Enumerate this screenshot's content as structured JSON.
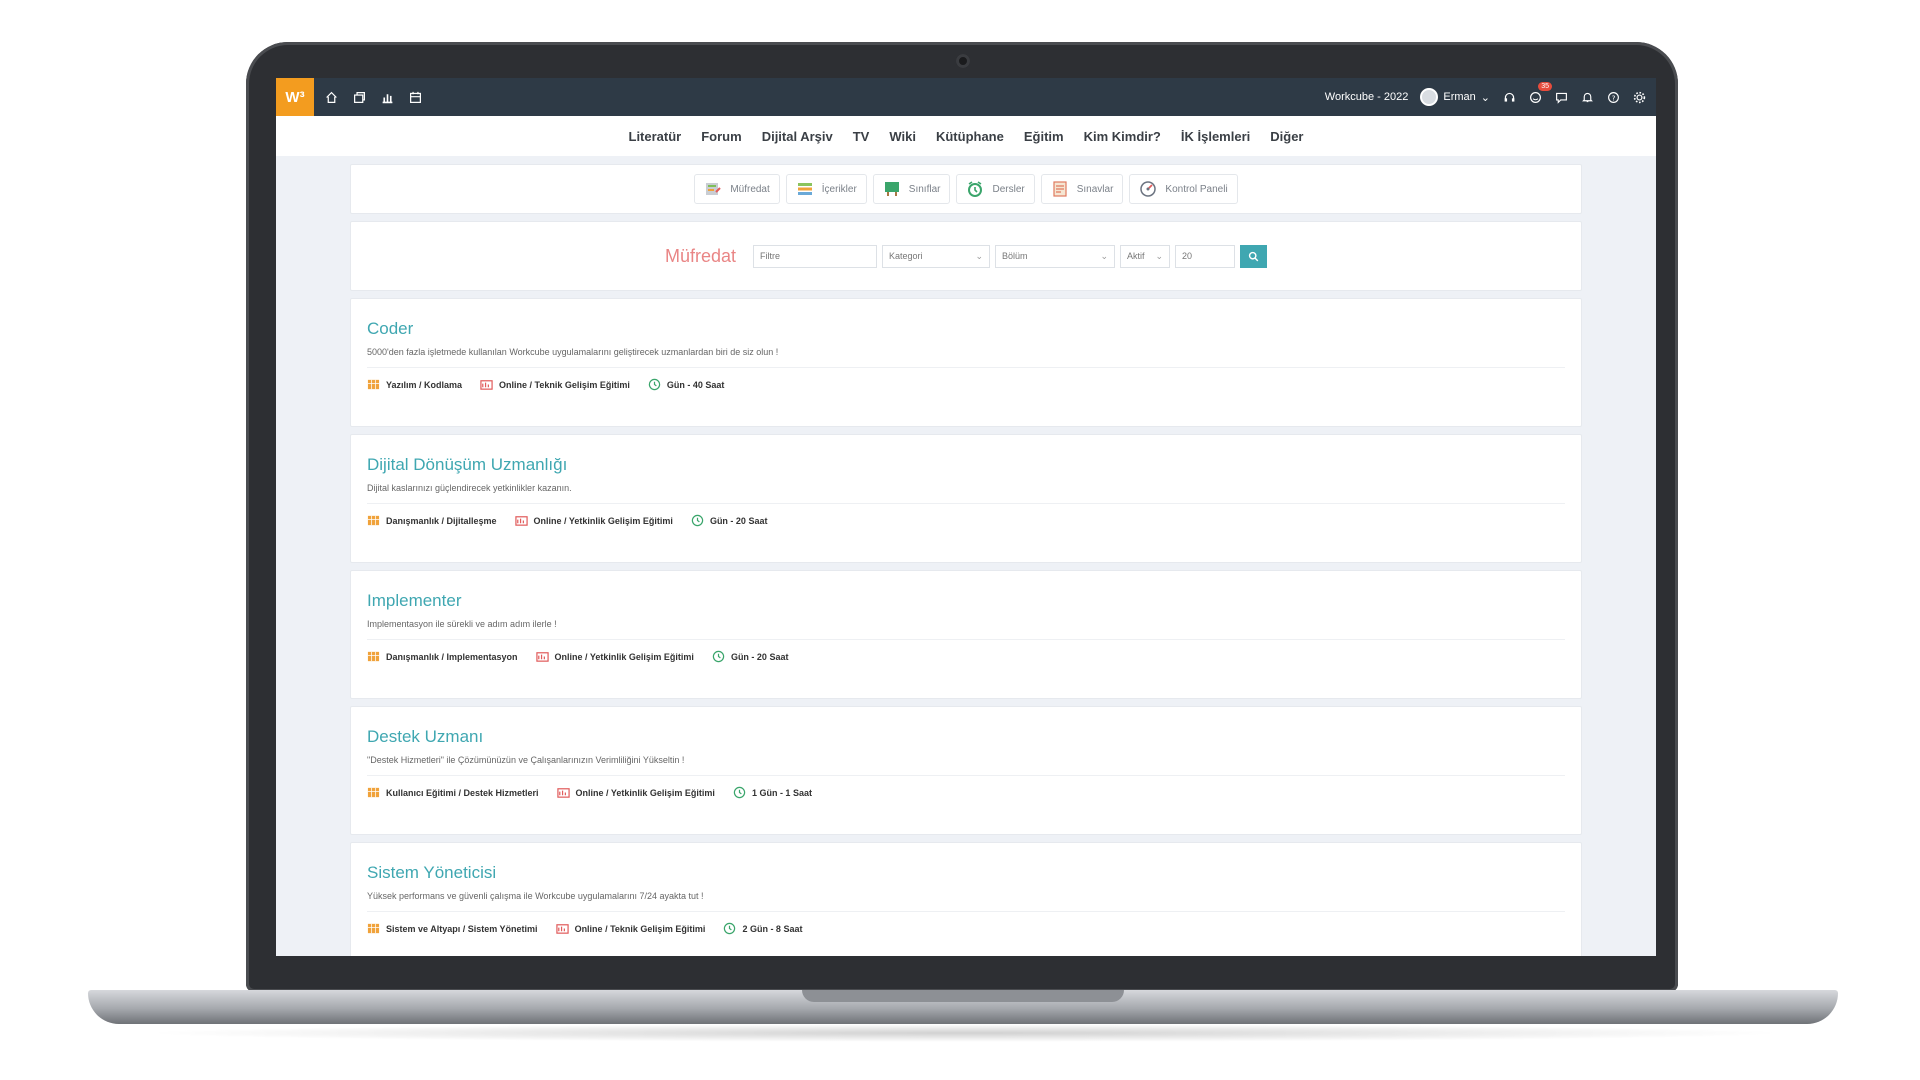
{
  "topbar": {
    "logo": "W³",
    "company": "Workcube - 2022",
    "user_name": "Erman",
    "notification_count": "35"
  },
  "mainnav": [
    "Literatür",
    "Forum",
    "Dijital Arşiv",
    "TV",
    "Wiki",
    "Kütüphane",
    "Eğitim",
    "Kim Kimdir?",
    "İK İşlemleri",
    "Diğer"
  ],
  "modules": [
    {
      "label": "Müfredat",
      "icon": "curriculum-icon"
    },
    {
      "label": "İçerikler",
      "icon": "contents-icon"
    },
    {
      "label": "Sınıflar",
      "icon": "classes-icon"
    },
    {
      "label": "Dersler",
      "icon": "lessons-icon"
    },
    {
      "label": "Sınavlar",
      "icon": "exams-icon"
    },
    {
      "label": "Kontrol Paneli",
      "icon": "dashboard-icon"
    }
  ],
  "filter": {
    "title": "Müfredat",
    "filter_placeholder": "Filtre",
    "category": "Kategori",
    "section": "Bölüm",
    "status": "Aktif",
    "count": "20"
  },
  "items": [
    {
      "title": "Coder",
      "desc": "5000'den fazla işletmede kullanılan Workcube uygulamalarını geliştirecek uzmanlardan biri de siz olun !",
      "category": "Yazılım / Kodlama",
      "type": "Online / Teknik Gelişim Eğitimi",
      "duration": "Gün - 40 Saat"
    },
    {
      "title": "Dijital Dönüşüm Uzmanlığı",
      "desc": "Dijital kaslarınızı güçlendirecek yetkinlikler kazanın.",
      "category": "Danışmanlık / Dijitalleşme",
      "type": "Online / Yetkinlik Gelişim Eğitimi",
      "duration": "Gün - 20 Saat"
    },
    {
      "title": "Implementer",
      "desc": "Implementasyon ile sürekli ve adım adım ilerle !",
      "category": "Danışmanlık / Implementasyon",
      "type": "Online / Yetkinlik Gelişim Eğitimi",
      "duration": "Gün - 20 Saat"
    },
    {
      "title": "Destek Uzmanı",
      "desc": "\"Destek Hizmetleri\" ile Çözümünüzün ve Çalışanlarınızın Verimliliğini Yükseltin !",
      "category": "Kullanıcı Eğitimi / Destek Hizmetleri",
      "type": "Online / Yetkinlik Gelişim Eğitimi",
      "duration": "1 Gün - 1 Saat"
    },
    {
      "title": "Sistem Yöneticisi",
      "desc": "Yüksek performans ve güvenli çalışma ile Workcube uygulamalarını 7/24 ayakta tut !",
      "category": "Sistem ve Altyapı / Sistem Yönetimi",
      "type": "Online / Teknik Gelişim Eğitimi",
      "duration": "2 Gün - 8 Saat"
    }
  ]
}
